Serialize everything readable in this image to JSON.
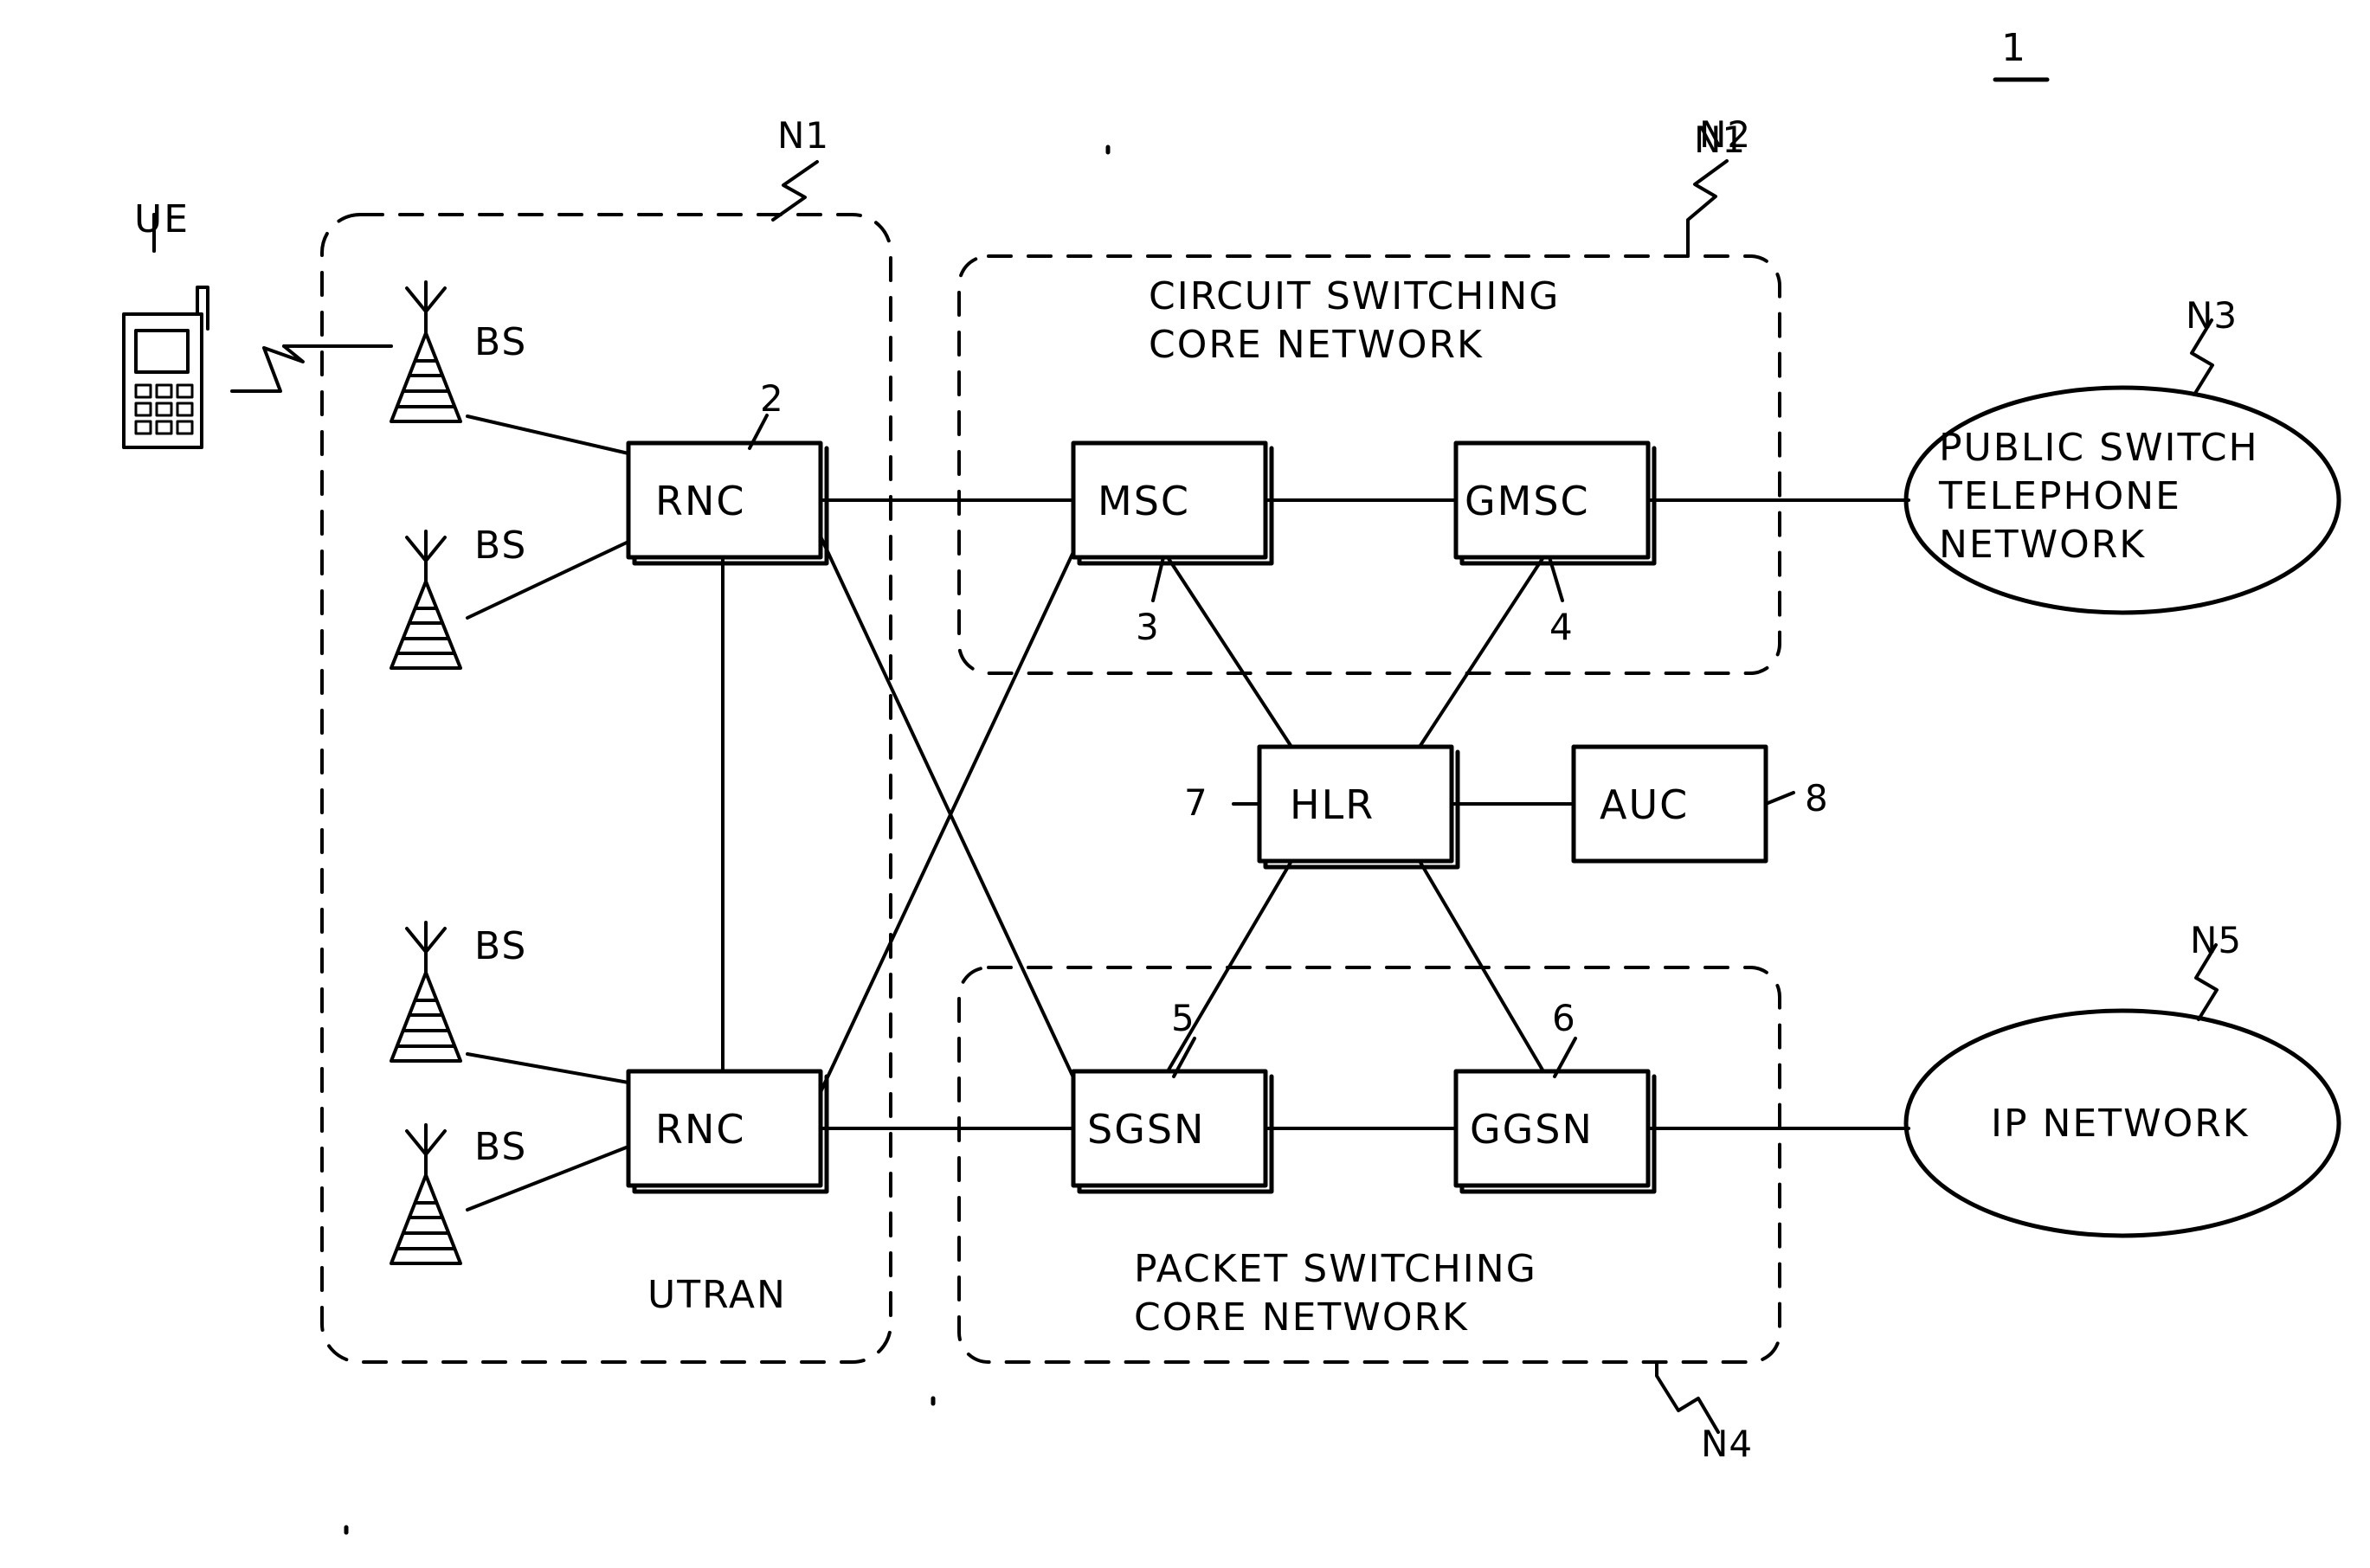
{
  "figure": {
    "number": "1"
  },
  "areas": {
    "utran": {
      "tag": "N1",
      "label": "UTRAN"
    },
    "circuit_switching": {
      "tag": "N2",
      "label_line1": "CIRCUIT SWITCHING",
      "label_line2": "CORE NETWORK"
    },
    "packet_switching": {
      "tag": "N4",
      "label_line1": "PACKET SWITCHING",
      "label_line2": "CORE NETWORK"
    }
  },
  "external_networks": [
    {
      "tag": "N3",
      "line1": "PUBLIC SWITCH",
      "line2": "TELEPHONE",
      "line3": "NETWORK"
    },
    {
      "tag": "N5",
      "line1": "IP NETWORK"
    }
  ],
  "terminal": {
    "label": "UE"
  },
  "base_stations": [
    {
      "label": "BS"
    },
    {
      "label": "BS"
    },
    {
      "label": "BS"
    },
    {
      "label": "BS"
    }
  ],
  "nodes": {
    "rnc_top": {
      "label": "RNC",
      "ref": "2"
    },
    "rnc_bottom": {
      "label": "RNC",
      "ref": ""
    },
    "msc": {
      "label": "MSC",
      "ref": "3"
    },
    "gmsc": {
      "label": "GMSC",
      "ref": "4"
    },
    "sgsn": {
      "label": "SGSN",
      "ref": "5"
    },
    "ggsn": {
      "label": "GGSN",
      "ref": "6"
    },
    "hlr": {
      "label": "HLR",
      "ref": "7"
    },
    "auc": {
      "label": "AUC",
      "ref": "8"
    }
  }
}
